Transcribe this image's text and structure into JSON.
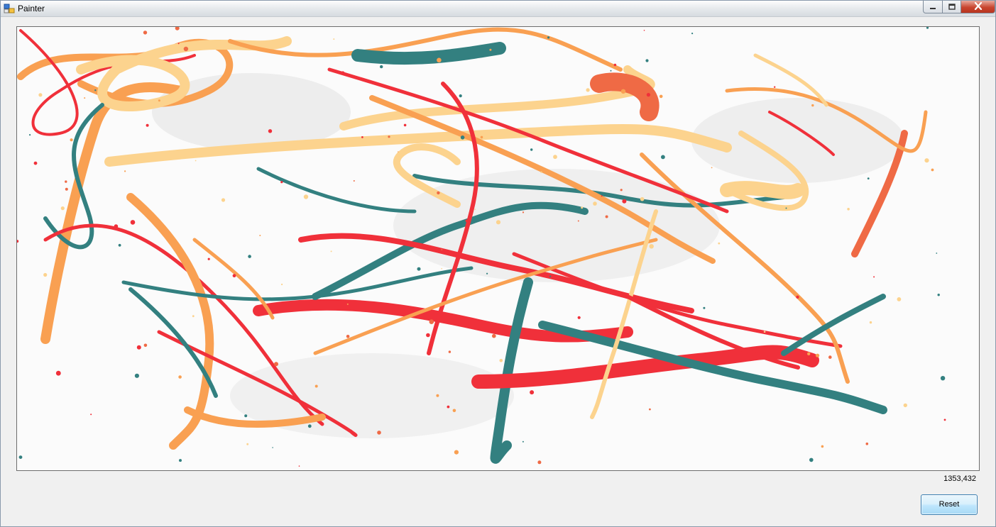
{
  "window": {
    "title": "Painter",
    "controls": {
      "minimize": "minimize-icon",
      "maximize": "maximize-icon",
      "close": "close-icon"
    }
  },
  "canvas": {
    "palette": [
      "#f0303a",
      "#338080",
      "#f9a052",
      "#fcd38e",
      "#ef6a45"
    ]
  },
  "status": {
    "coordinates": "1353,432"
  },
  "actions": {
    "reset_label": "Reset"
  }
}
